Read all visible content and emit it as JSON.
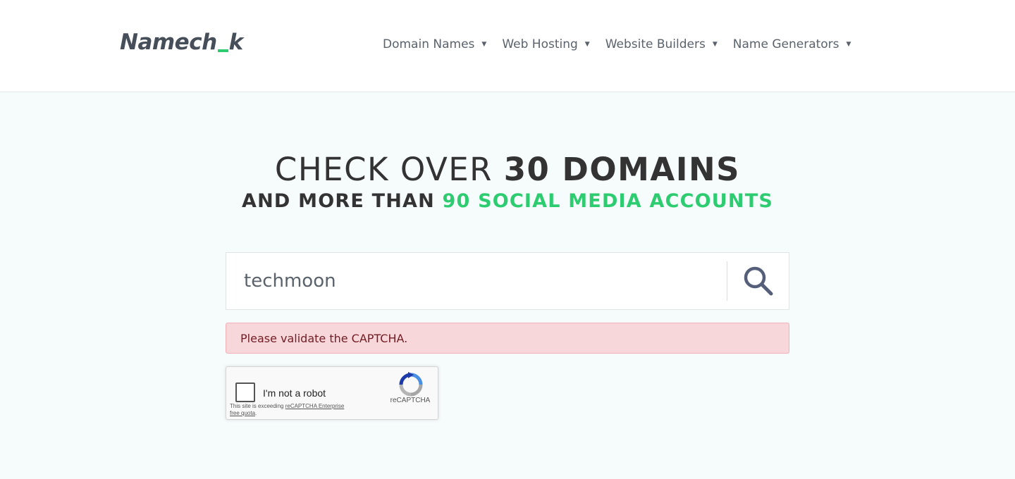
{
  "header": {
    "logo": {
      "part1": "Namech",
      "part2": "k"
    },
    "nav": [
      {
        "label": "Domain Names"
      },
      {
        "label": "Web Hosting"
      },
      {
        "label": "Website Builders"
      },
      {
        "label": "Name Generators"
      }
    ]
  },
  "hero": {
    "line1_prefix": "CHECK OVER ",
    "line1_bold": "30 DOMAINS",
    "line2_prefix": "AND MORE THAN ",
    "line2_green": "90 SOCIAL MEDIA ACCOUNTS"
  },
  "search": {
    "value": "techmoon"
  },
  "alert": {
    "message": "Please validate the CAPTCHA."
  },
  "captcha": {
    "label": "I'm not a robot",
    "note_prefix": "This site is exceeding ",
    "note_link": "reCAPTCHA Enterprise free quota",
    "note_suffix": ".",
    "brand": "reCAPTCHA"
  },
  "colors": {
    "accent": "#2ecc71",
    "alert_bg": "#f8d7da",
    "alert_text": "#721c24",
    "page_bg": "#f6fbfb"
  }
}
